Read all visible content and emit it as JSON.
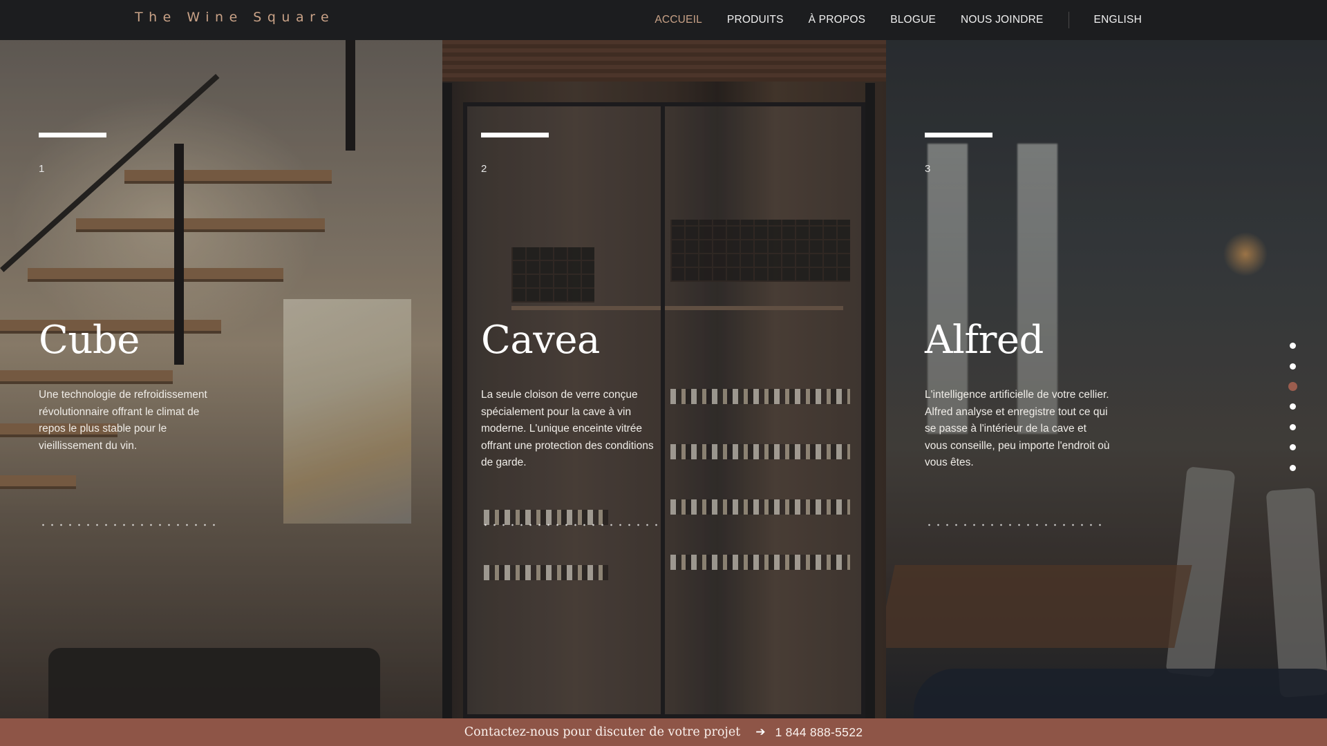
{
  "header": {
    "logo": "The Wine Square",
    "nav": [
      {
        "label": "ACCUEIL",
        "active": true
      },
      {
        "label": "PRODUITS",
        "active": false
      },
      {
        "label": "À PROPOS",
        "active": false
      },
      {
        "label": "BLOGUE",
        "active": false
      },
      {
        "label": "NOUS JOINDRE",
        "active": false
      }
    ],
    "language": "ENGLISH"
  },
  "panels": [
    {
      "number": "1",
      "title": "Cube",
      "description": "Une technologie de refroidissement révolutionnaire offrant le climat de repos le plus stable pour le vieillissement du vin."
    },
    {
      "number": "2",
      "title": "Cavea",
      "description": "La seule cloison de verre conçue spécialement pour la cave à vin moderne. L'unique enceinte vitrée offrant une protection des conditions de garde."
    },
    {
      "number": "3",
      "title": "Alfred",
      "description": "L'intelligence artificielle de votre cellier. Alfred analyse et enregistre tout ce qui se passe à l'intérieur de la cave et vous conseille, peu importe l'endroit où vous êtes."
    }
  ],
  "pager": {
    "count": 7,
    "active_index": 2
  },
  "footer": {
    "cta_text": "Contactez-nous pour discuter de votre projet",
    "arrow": "➔",
    "phone": "1 844 888-5522"
  },
  "colors": {
    "accent": "#c9a287",
    "cta_background": "#8e5547",
    "pager_active": "#9b5d4e",
    "header_background": "#1c1d1f"
  }
}
